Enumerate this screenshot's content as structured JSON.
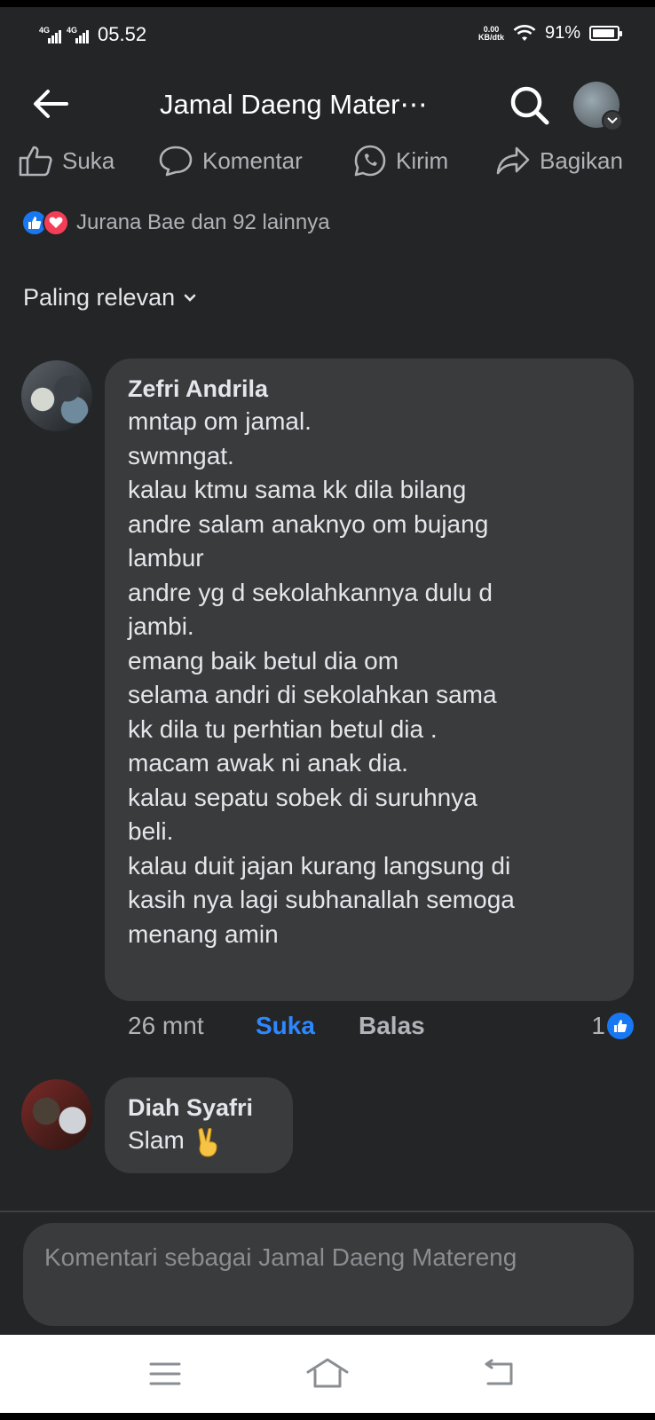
{
  "status_bar": {
    "network_1": "4G",
    "network_2": "4G",
    "time": "05.52",
    "net_speed_value": "0.00",
    "net_speed_unit": "KB/dtk",
    "battery_percent": "91%",
    "battery_level": 0.91
  },
  "header": {
    "title": "Jamal Daeng Mater⋯"
  },
  "actions": {
    "like": "Suka",
    "comment": "Komentar",
    "send": "Kirim",
    "share": "Bagikan"
  },
  "reactions": {
    "summary": "Jurana Bae dan 92 lainnya"
  },
  "sort": {
    "label": "Paling relevan"
  },
  "comments": [
    {
      "author": "Zefri Andrila",
      "lines": [
        "mntap om jamal.",
        "swmngat.",
        "kalau ktmu sama kk dila bilang",
        "andre salam anaknyo om bujang",
        "lambur",
        "andre yg d sekolahkannya dulu d",
        "jambi.",
        "emang baik betul dia om",
        "selama andri di sekolahkan sama",
        "kk dila tu perhtian betul dia .",
        "macam awak ni anak dia.",
        "kalau sepatu sobek di suruhnya",
        "beli.",
        "kalau duit jajan kurang langsung di",
        "kasih nya lagi subhanallah semoga",
        "menang amin"
      ],
      "time": "26 mnt",
      "like_label": "Suka",
      "reply_label": "Balas",
      "like_count": "1"
    },
    {
      "author": "Diah Syafri",
      "text": "Slam"
    }
  ],
  "composer": {
    "placeholder": "Komentari sebagai Jamal Daeng Matereng"
  },
  "colors": {
    "background": "#242526",
    "bubble": "#3a3b3c",
    "accent_blue": "#1877f2",
    "love_red": "#f33e58"
  }
}
